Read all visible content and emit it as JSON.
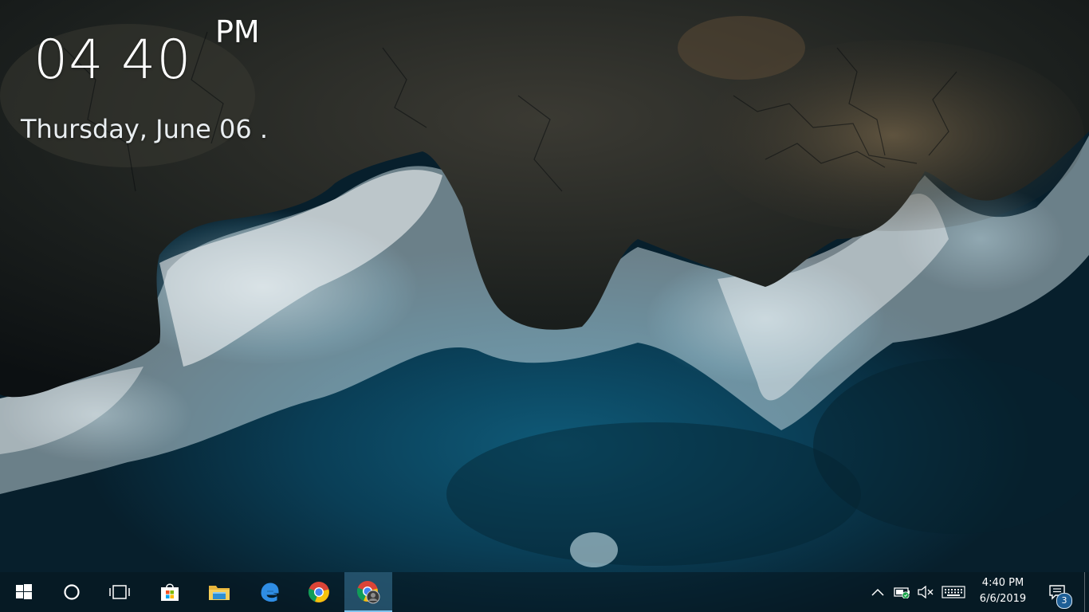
{
  "clock_widget": {
    "hour": "04",
    "minute": "40",
    "ampm": "PM",
    "date": "Thursday, June 06 ."
  },
  "taskbar": {
    "buttons": [
      {
        "name": "start",
        "icon": "windows-logo-icon"
      },
      {
        "name": "search",
        "icon": "cortana-circle-icon"
      },
      {
        "name": "task-view",
        "icon": "task-view-icon"
      },
      {
        "name": "store",
        "icon": "store-bag-icon"
      },
      {
        "name": "file-explorer",
        "icon": "folder-icon"
      },
      {
        "name": "edge",
        "icon": "edge-icon"
      },
      {
        "name": "chrome",
        "icon": "chrome-icon"
      },
      {
        "name": "chrome-profile",
        "icon": "chrome-profile-icon",
        "active": true
      }
    ],
    "tray": {
      "icons": [
        "chevron-up-icon",
        "battery-charging-icon",
        "volume-muted-icon",
        "keyboard-icon"
      ],
      "time": "4:40 PM",
      "date": "6/6/2019",
      "notification_count": "3"
    }
  },
  "colors": {
    "taskbar_accent": "#7fc3ee",
    "notification_badge": "#1e5f96"
  }
}
